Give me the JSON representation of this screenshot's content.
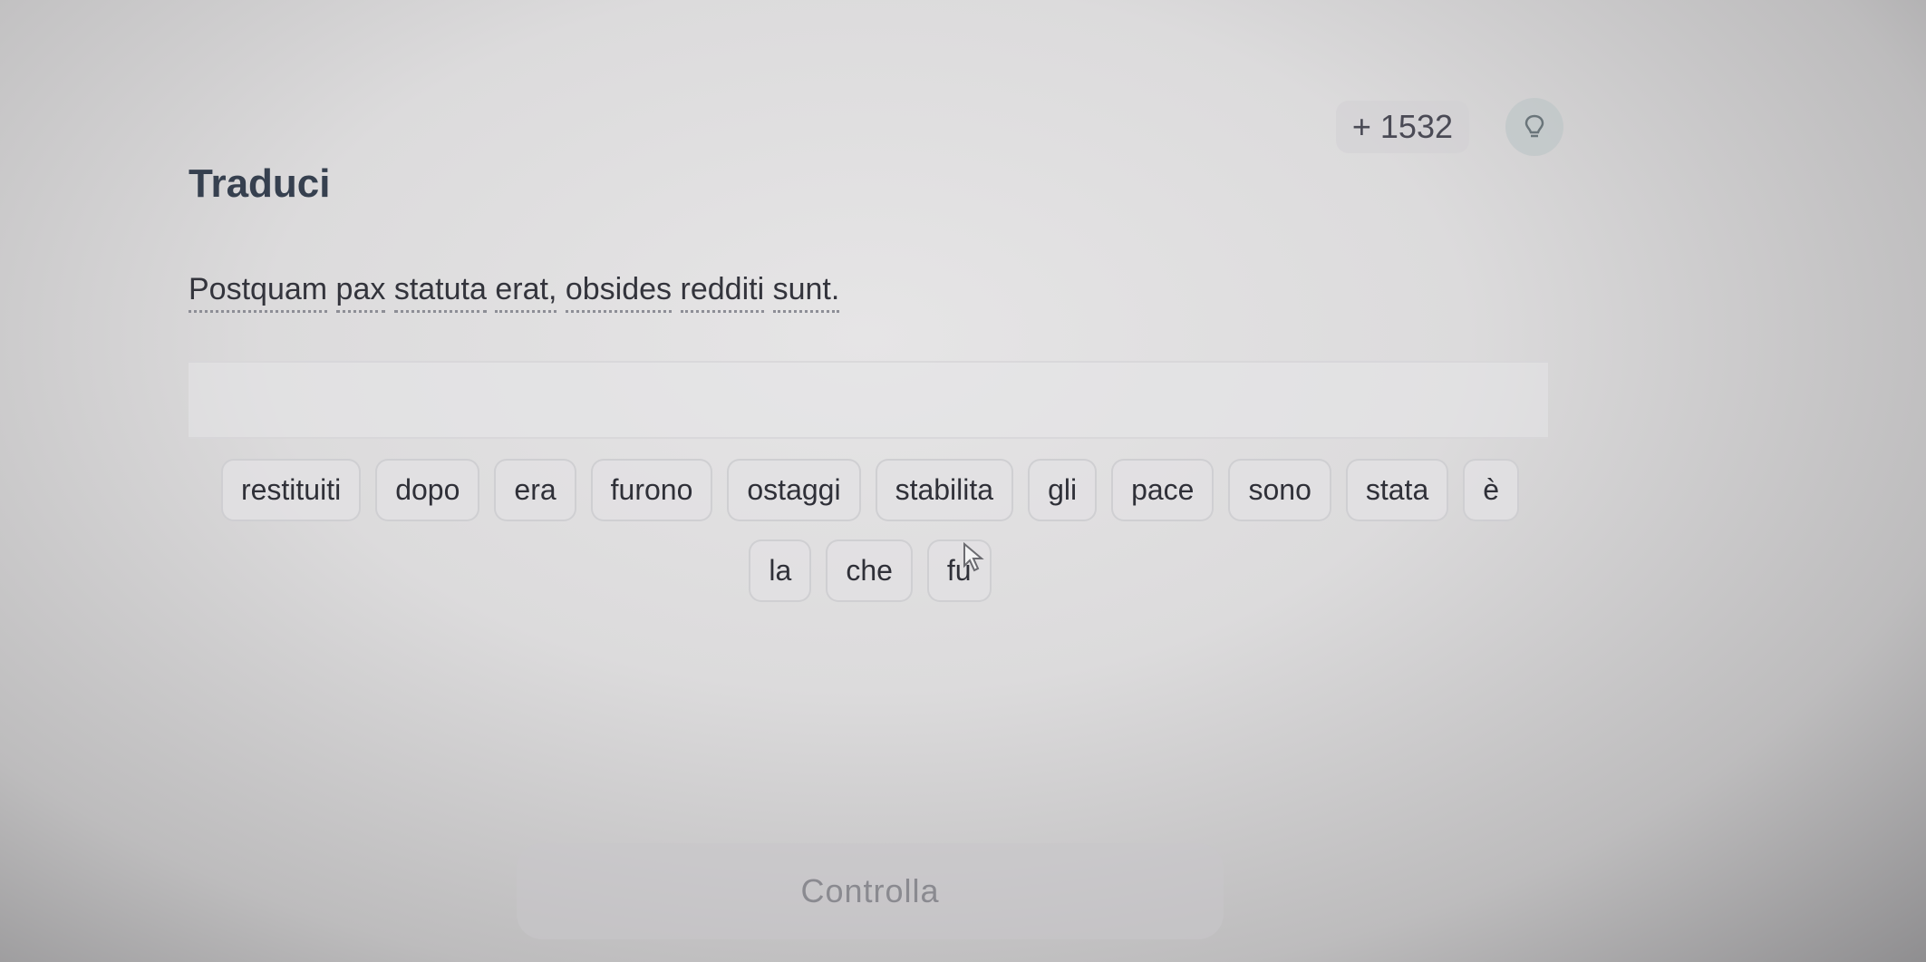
{
  "header": {
    "xp_value": "+ 1532",
    "hint_icon": "lightbulb-icon"
  },
  "exercise": {
    "title": "Traduci",
    "source_words": [
      "Postquam",
      "pax",
      "statuta",
      "erat,",
      "obsides",
      "redditi",
      "sunt."
    ]
  },
  "word_bank": [
    "restituiti",
    "dopo",
    "era",
    "furono",
    "ostaggi",
    "stabilita",
    "gli",
    "pace",
    "sono",
    "stata",
    "è",
    "la",
    "che",
    "fu"
  ],
  "actions": {
    "check_label": "Controlla"
  },
  "colors": {
    "title": "#36404f",
    "text": "#33343c",
    "button_text": "#8a8a90"
  }
}
